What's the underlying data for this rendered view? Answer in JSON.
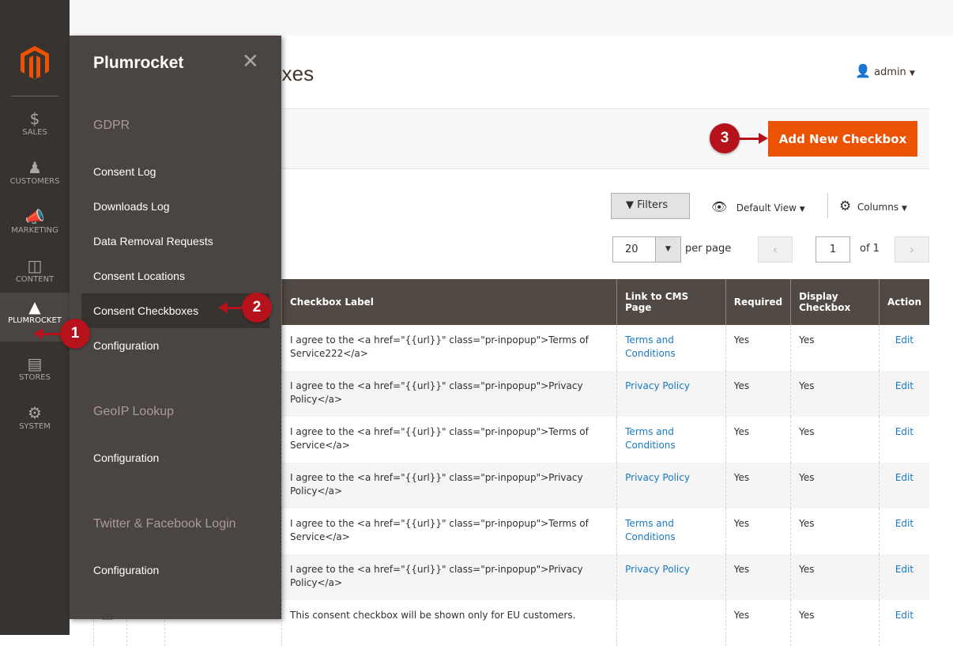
{
  "nav": {
    "items": [
      {
        "label": "SALES",
        "icon": "dollar-icon"
      },
      {
        "label": "CUSTOMERS",
        "icon": "person-icon"
      },
      {
        "label": "MARKETING",
        "icon": "megaphone-icon"
      },
      {
        "label": "CONTENT",
        "icon": "layout-icon"
      },
      {
        "label": "PLUMROCKET",
        "icon": "plumrocket-icon"
      },
      {
        "label": "STORES",
        "icon": "store-icon"
      },
      {
        "label": "SYSTEM",
        "icon": "gear-icon"
      }
    ]
  },
  "header": {
    "title": "Consent Checkboxes",
    "user": "admin"
  },
  "actions": {
    "add_new": "Add New Checkbox"
  },
  "toolbar": {
    "filters": "Filters",
    "view": "Default View",
    "columns": "Columns",
    "per_page_value": "20",
    "per_page_label": "per page",
    "page": "1",
    "of": "of 1"
  },
  "table": {
    "headers": [
      "Checkbox Label",
      "Link to CMS Page",
      "Required",
      "Display Checkbox",
      "Action"
    ],
    "rows": [
      {
        "label": "I agree to the <a href=\"{{url}}\" class=\"pr-inpopup\">Terms of Service222</a>",
        "link": "Terms and Conditions",
        "required": "Yes",
        "display": "Yes",
        "action": "Edit"
      },
      {
        "label": "I agree to the <a href=\"{{url}}\" class=\"pr-inpopup\">Privacy Policy</a>",
        "link": "Privacy Policy",
        "required": "Yes",
        "display": "Yes",
        "action": "Edit"
      },
      {
        "label": "I agree to the <a href=\"{{url}}\" class=\"pr-inpopup\">Terms of Service</a>",
        "link": "Terms and Conditions",
        "required": "Yes",
        "display": "Yes",
        "action": "Edit"
      },
      {
        "label": "I agree to the <a href=\"{{url}}\" class=\"pr-inpopup\">Privacy Policy</a>",
        "link": "Privacy Policy",
        "required": "Yes",
        "display": "Yes",
        "action": "Edit"
      },
      {
        "label": "I agree to the <a href=\"{{url}}\" class=\"pr-inpopup\">Terms of Service</a>",
        "link": "Terms and Conditions",
        "required": "Yes",
        "display": "Yes",
        "action": "Edit"
      },
      {
        "label": "I agree to the <a href=\"{{url}}\" class=\"pr-inpopup\">Privacy Policy</a>",
        "link": "Privacy Policy",
        "required": "Yes",
        "display": "Yes",
        "action": "Edit"
      },
      {
        "label": "This consent checkbox will be shown only for EU customers.",
        "link": "",
        "required": "Yes",
        "display": "Yes",
        "action": "Edit"
      }
    ]
  },
  "flyout": {
    "title": "Plumrocket",
    "sections": [
      {
        "title": "GDPR",
        "items": [
          "Consent Log",
          "Downloads Log",
          "Data Removal Requests",
          "Consent Locations",
          "Consent Checkboxes",
          "Configuration"
        ]
      },
      {
        "title": "GeoIP Lookup",
        "items": [
          "Configuration"
        ]
      },
      {
        "title": "Twitter & Facebook Login",
        "items": [
          "Configuration"
        ]
      }
    ]
  },
  "callouts": [
    "1",
    "2",
    "3"
  ],
  "colors": {
    "accent": "#eb5202",
    "callout": "#b5121b",
    "nav": "#373330",
    "flyout": "#4a4542",
    "table_header": "#514943",
    "link": "#1979c3"
  }
}
